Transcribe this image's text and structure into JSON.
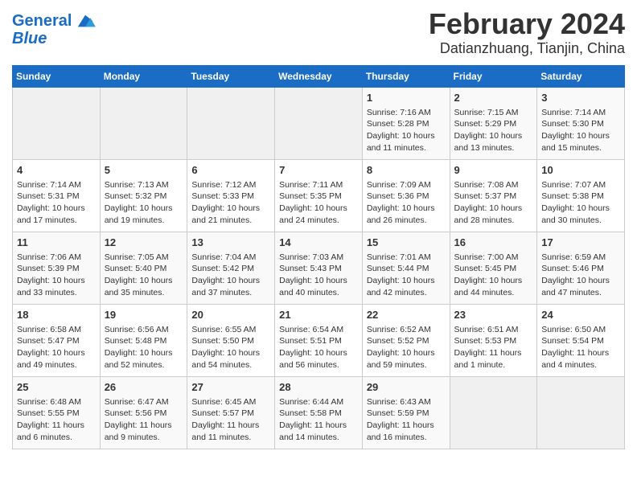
{
  "header": {
    "logo_line1": "General",
    "logo_line2": "Blue",
    "month_year": "February 2024",
    "location": "Datianzhuang, Tianjin, China"
  },
  "days_of_week": [
    "Sunday",
    "Monday",
    "Tuesday",
    "Wednesday",
    "Thursday",
    "Friday",
    "Saturday"
  ],
  "weeks": [
    [
      {
        "day": "",
        "content": ""
      },
      {
        "day": "",
        "content": ""
      },
      {
        "day": "",
        "content": ""
      },
      {
        "day": "",
        "content": ""
      },
      {
        "day": "1",
        "content": "Sunrise: 7:16 AM\nSunset: 5:28 PM\nDaylight: 10 hours\nand 11 minutes."
      },
      {
        "day": "2",
        "content": "Sunrise: 7:15 AM\nSunset: 5:29 PM\nDaylight: 10 hours\nand 13 minutes."
      },
      {
        "day": "3",
        "content": "Sunrise: 7:14 AM\nSunset: 5:30 PM\nDaylight: 10 hours\nand 15 minutes."
      }
    ],
    [
      {
        "day": "4",
        "content": "Sunrise: 7:14 AM\nSunset: 5:31 PM\nDaylight: 10 hours\nand 17 minutes."
      },
      {
        "day": "5",
        "content": "Sunrise: 7:13 AM\nSunset: 5:32 PM\nDaylight: 10 hours\nand 19 minutes."
      },
      {
        "day": "6",
        "content": "Sunrise: 7:12 AM\nSunset: 5:33 PM\nDaylight: 10 hours\nand 21 minutes."
      },
      {
        "day": "7",
        "content": "Sunrise: 7:11 AM\nSunset: 5:35 PM\nDaylight: 10 hours\nand 24 minutes."
      },
      {
        "day": "8",
        "content": "Sunrise: 7:09 AM\nSunset: 5:36 PM\nDaylight: 10 hours\nand 26 minutes."
      },
      {
        "day": "9",
        "content": "Sunrise: 7:08 AM\nSunset: 5:37 PM\nDaylight: 10 hours\nand 28 minutes."
      },
      {
        "day": "10",
        "content": "Sunrise: 7:07 AM\nSunset: 5:38 PM\nDaylight: 10 hours\nand 30 minutes."
      }
    ],
    [
      {
        "day": "11",
        "content": "Sunrise: 7:06 AM\nSunset: 5:39 PM\nDaylight: 10 hours\nand 33 minutes."
      },
      {
        "day": "12",
        "content": "Sunrise: 7:05 AM\nSunset: 5:40 PM\nDaylight: 10 hours\nand 35 minutes."
      },
      {
        "day": "13",
        "content": "Sunrise: 7:04 AM\nSunset: 5:42 PM\nDaylight: 10 hours\nand 37 minutes."
      },
      {
        "day": "14",
        "content": "Sunrise: 7:03 AM\nSunset: 5:43 PM\nDaylight: 10 hours\nand 40 minutes."
      },
      {
        "day": "15",
        "content": "Sunrise: 7:01 AM\nSunset: 5:44 PM\nDaylight: 10 hours\nand 42 minutes."
      },
      {
        "day": "16",
        "content": "Sunrise: 7:00 AM\nSunset: 5:45 PM\nDaylight: 10 hours\nand 44 minutes."
      },
      {
        "day": "17",
        "content": "Sunrise: 6:59 AM\nSunset: 5:46 PM\nDaylight: 10 hours\nand 47 minutes."
      }
    ],
    [
      {
        "day": "18",
        "content": "Sunrise: 6:58 AM\nSunset: 5:47 PM\nDaylight: 10 hours\nand 49 minutes."
      },
      {
        "day": "19",
        "content": "Sunrise: 6:56 AM\nSunset: 5:48 PM\nDaylight: 10 hours\nand 52 minutes."
      },
      {
        "day": "20",
        "content": "Sunrise: 6:55 AM\nSunset: 5:50 PM\nDaylight: 10 hours\nand 54 minutes."
      },
      {
        "day": "21",
        "content": "Sunrise: 6:54 AM\nSunset: 5:51 PM\nDaylight: 10 hours\nand 56 minutes."
      },
      {
        "day": "22",
        "content": "Sunrise: 6:52 AM\nSunset: 5:52 PM\nDaylight: 10 hours\nand 59 minutes."
      },
      {
        "day": "23",
        "content": "Sunrise: 6:51 AM\nSunset: 5:53 PM\nDaylight: 11 hours\nand 1 minute."
      },
      {
        "day": "24",
        "content": "Sunrise: 6:50 AM\nSunset: 5:54 PM\nDaylight: 11 hours\nand 4 minutes."
      }
    ],
    [
      {
        "day": "25",
        "content": "Sunrise: 6:48 AM\nSunset: 5:55 PM\nDaylight: 11 hours\nand 6 minutes."
      },
      {
        "day": "26",
        "content": "Sunrise: 6:47 AM\nSunset: 5:56 PM\nDaylight: 11 hours\nand 9 minutes."
      },
      {
        "day": "27",
        "content": "Sunrise: 6:45 AM\nSunset: 5:57 PM\nDaylight: 11 hours\nand 11 minutes."
      },
      {
        "day": "28",
        "content": "Sunrise: 6:44 AM\nSunset: 5:58 PM\nDaylight: 11 hours\nand 14 minutes."
      },
      {
        "day": "29",
        "content": "Sunrise: 6:43 AM\nSunset: 5:59 PM\nDaylight: 11 hours\nand 16 minutes."
      },
      {
        "day": "",
        "content": ""
      },
      {
        "day": "",
        "content": ""
      }
    ]
  ]
}
